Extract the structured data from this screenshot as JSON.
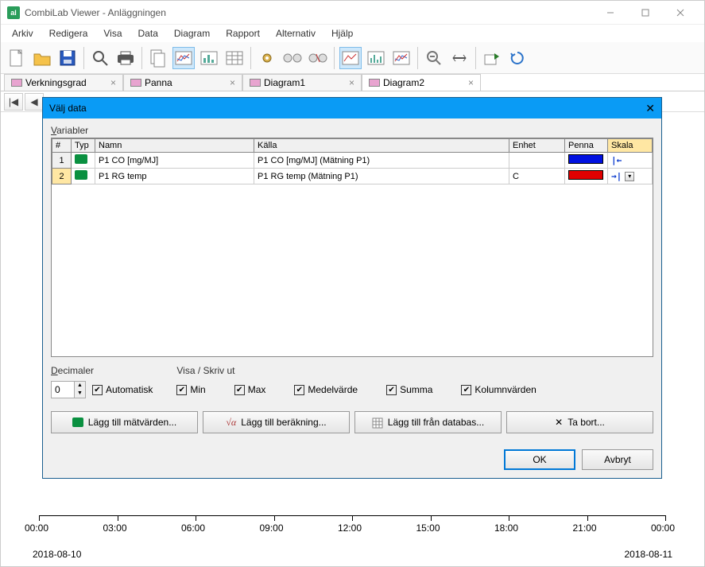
{
  "window": {
    "title": "CombiLab Viewer - Anläggningen",
    "app_icon_text": "al"
  },
  "menu": [
    "Arkiv",
    "Redigera",
    "Visa",
    "Data",
    "Diagram",
    "Rapport",
    "Alternativ",
    "Hjälp"
  ],
  "tabs": [
    {
      "label": "Verkningsgrad",
      "active": false
    },
    {
      "label": "Panna",
      "active": false
    },
    {
      "label": "Diagram1",
      "active": false
    },
    {
      "label": "Diagram2",
      "active": true
    }
  ],
  "dialog": {
    "title": "Välj data",
    "vars_label": "Variabler",
    "columns": {
      "num": "#",
      "typ": "Typ",
      "namn": "Namn",
      "kalla": "Källa",
      "enhet": "Enhet",
      "penna": "Penna",
      "skala": "Skala"
    },
    "rows": [
      {
        "idx": "1",
        "namn": "P1 CO [mg/MJ]",
        "kalla": "P1 CO [mg/MJ] (Mätning P1)",
        "enhet": "",
        "pen": "#0010E0",
        "skala": "left"
      },
      {
        "idx": "2",
        "namn": "P1 RG temp",
        "kalla": "P1 RG temp (Mätning P1)",
        "enhet": "C",
        "pen": "#E00000",
        "skala": "right"
      }
    ],
    "decimals_label": "Decimaler",
    "decimals_value": "0",
    "auto_label": "Automatisk",
    "visa_label": "Visa / Skriv ut",
    "checks": {
      "min": "Min",
      "max": "Max",
      "medel": "Medelvärde",
      "summa": "Summa",
      "kolumn": "Kolumnvärden"
    },
    "buttons": {
      "add_meas": "Lägg till mätvärden...",
      "add_calc": "Lägg till beräkning...",
      "add_db": "Lägg till från databas...",
      "remove": "Ta bort..."
    },
    "ok": "OK",
    "cancel": "Avbryt"
  },
  "chart_data": {
    "type": "line",
    "title": "",
    "xlabel": "",
    "ylabel": "",
    "x_ticks": [
      "00:00",
      "03:00",
      "06:00",
      "09:00",
      "12:00",
      "15:00",
      "18:00",
      "21:00",
      "00:00"
    ],
    "date_start": "2018-08-10",
    "date_end": "2018-08-11",
    "series": []
  }
}
